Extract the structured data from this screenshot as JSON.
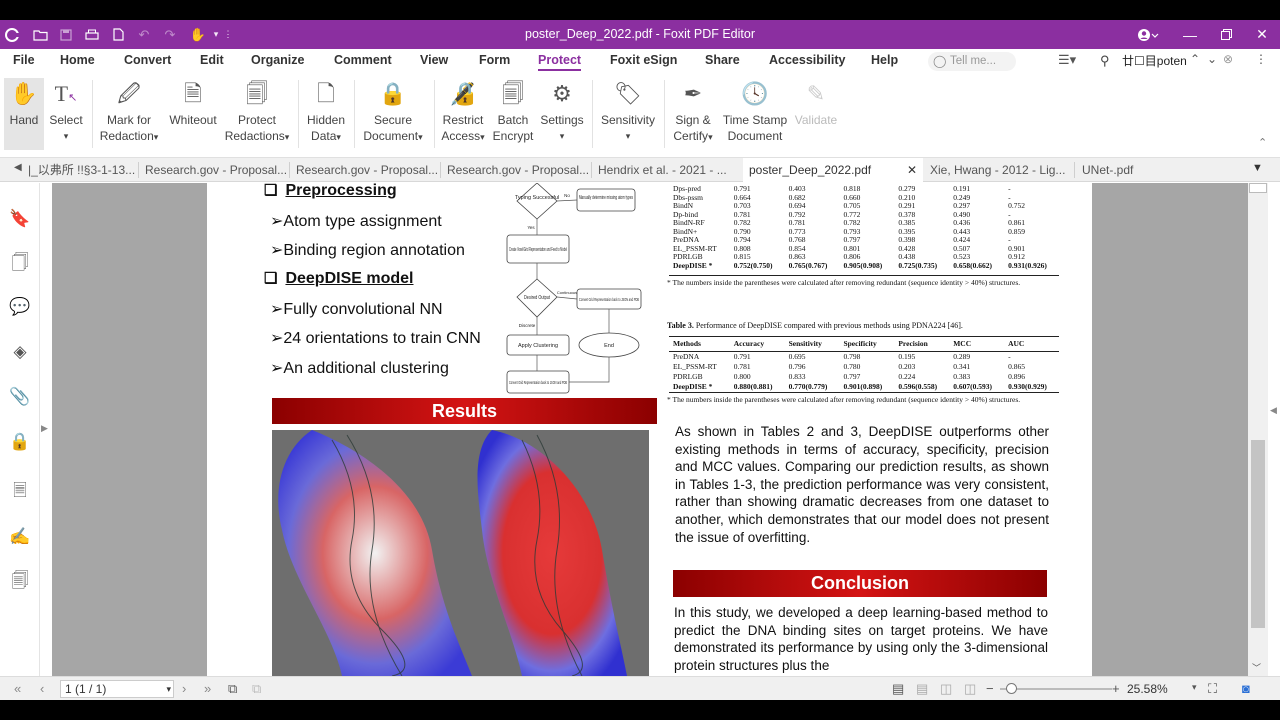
{
  "app": {
    "title": "poster_Deep_2022.pdf - Foxit PDF Editor",
    "accent": "#8b2fa0"
  },
  "menu": {
    "items": [
      "File",
      "Home",
      "Convert",
      "Edit",
      "Organize",
      "Comment",
      "View",
      "Form",
      "Protect",
      "Foxit eSign",
      "Share",
      "Accessibility",
      "Help"
    ],
    "active": "Protect",
    "tell_me_placeholder": "Tell me...",
    "search_text": "poten"
  },
  "ribbon": {
    "hand": "Hand",
    "select": "Select",
    "mark_for": "Mark for",
    "redaction": "Redaction",
    "whiteout": "Whiteout",
    "protect": "Protect",
    "redactions": "Redactions",
    "hidden": "Hidden",
    "data": "Data",
    "secure": "Secure",
    "document": "Document",
    "restrict": "Restrict",
    "access": "Access",
    "batch": "Batch",
    "encrypt": "Encrypt",
    "settings": "Settings",
    "sensitivity": "Sensitivity",
    "sign_and": "Sign &",
    "certify": "Certify",
    "time_stamp": "Time Stamp",
    "ts_document": "Document",
    "validate": "Validate"
  },
  "tabs": [
    "|_以弗所 !!§3-1-13...",
    "Research.gov - Proposal...",
    "Research.gov - Proposal...",
    "Research.gov - Proposal...",
    "Hendrix et al. - 2021 - ...",
    "poster_Deep_2022.pdf",
    "Xie, Hwang - 2012 - Lig...",
    "UNet-.pdf"
  ],
  "active_tab": "poster_Deep_2022.pdf",
  "poster": {
    "preprocessing": "Preprocessing",
    "atom_type": "Atom type assignment",
    "binding_region": "Binding region annotation",
    "model_heading": "DeepDISE model",
    "fully_conv": "Fully convolutional NN",
    "orientations": "24 orientations to train CNN",
    "clustering": "An additional clustering",
    "results": "Results",
    "conclusion": "Conclusion",
    "flow": {
      "typing": "Typing Successful",
      "no": "No",
      "manual": "Manually determine missing atom types",
      "yes": "Yes",
      "create": "Create Voxel/Grid Representation and Feed to Model",
      "desired": "Desired Output",
      "continuous": "Continuous",
      "convert1": "Convert Grid Representation back to JSON and PDB",
      "discrete": "Discrete",
      "apply": "Apply Clustering",
      "end": "End",
      "convert2": "Convert Grid Representation back to JSON and PDB"
    },
    "table2_rows": [
      [
        "Dps-pred",
        "0.791",
        "0.403",
        "0.818",
        "0.279",
        "0.191",
        "-"
      ],
      [
        "Dbs-pssm",
        "0.664",
        "0.682",
        "0.660",
        "0.210",
        "0.249",
        "-"
      ],
      [
        "BindN",
        "0.703",
        "0.694",
        "0.705",
        "0.291",
        "0.297",
        "0.752"
      ],
      [
        "Dp-bind",
        "0.781",
        "0.792",
        "0.772",
        "0.378",
        "0.490",
        "-"
      ],
      [
        "BindN-RF",
        "0.782",
        "0.781",
        "0.782",
        "0.385",
        "0.436",
        "0.861"
      ],
      [
        "BindN+",
        "0.790",
        "0.773",
        "0.793",
        "0.395",
        "0.443",
        "0.859"
      ],
      [
        "PreDNA",
        "0.794",
        "0.768",
        "0.797",
        "0.398",
        "0.424",
        "-"
      ],
      [
        "EL_PSSM-RT",
        "0.808",
        "0.854",
        "0.801",
        "0.428",
        "0.507",
        "0.901"
      ],
      [
        "PDRLGB",
        "0.815",
        "0.863",
        "0.806",
        "0.438",
        "0.523",
        "0.912"
      ],
      [
        "DeepDISE *",
        "0.752(0.750)",
        "0.765(0.767)",
        "0.905(0.908)",
        "0.725(0.735)",
        "0.658(0.662)",
        "0.931(0.926)"
      ]
    ],
    "table2_note": "* The numbers inside the parentheses were calculated after removing redundant (sequence identity > 40%) structures.",
    "table3_caption_bold": "Table 3.",
    "table3_caption": "Performance of DeepDISE compared with previous methods using PDNA224 [46].",
    "table3_headers": [
      "Methods",
      "Accuracy",
      "Sensitivity",
      "Specificity",
      "Precision",
      "MCC",
      "AUC"
    ],
    "table3_rows": [
      [
        "PreDNA",
        "0.791",
        "0.695",
        "0.798",
        "0.195",
        "0.289",
        "-"
      ],
      [
        "EL_PSSM-RT",
        "0.781",
        "0.796",
        "0.780",
        "0.203",
        "0.341",
        "0.865"
      ],
      [
        "PDRLGB",
        "0.800",
        "0.833",
        "0.797",
        "0.224",
        "0.383",
        "0.896"
      ],
      [
        "DeepDISE *",
        "0.880(0.881)",
        "0.770(0.779)",
        "0.901(0.898)",
        "0.596(0.558)",
        "0.607(0.593)",
        "0.930(0.929)"
      ]
    ],
    "table3_note": "* The numbers inside the parentheses were calculated after removing redundant (sequence identity > 40%) structures.",
    "results_para": "As shown in Tables 2 and 3, DeepDISE outperforms other existing methods in terms of accuracy, specificity, precision and MCC values. Comparing our prediction results, as shown in Tables 1-3, the prediction performance was very consistent, rather than showing dramatic decreases from one dataset to another, which demonstrates that our model does not present the issue of overfitting.",
    "conclusion_para": "In this study, we developed a deep learning-based method to predict the DNA binding sites on target proteins. We have demonstrated its performance by using only the 3-dimensional protein structures plus the"
  },
  "status": {
    "page": "1 (1 / 1)",
    "zoom": "25.58%"
  }
}
